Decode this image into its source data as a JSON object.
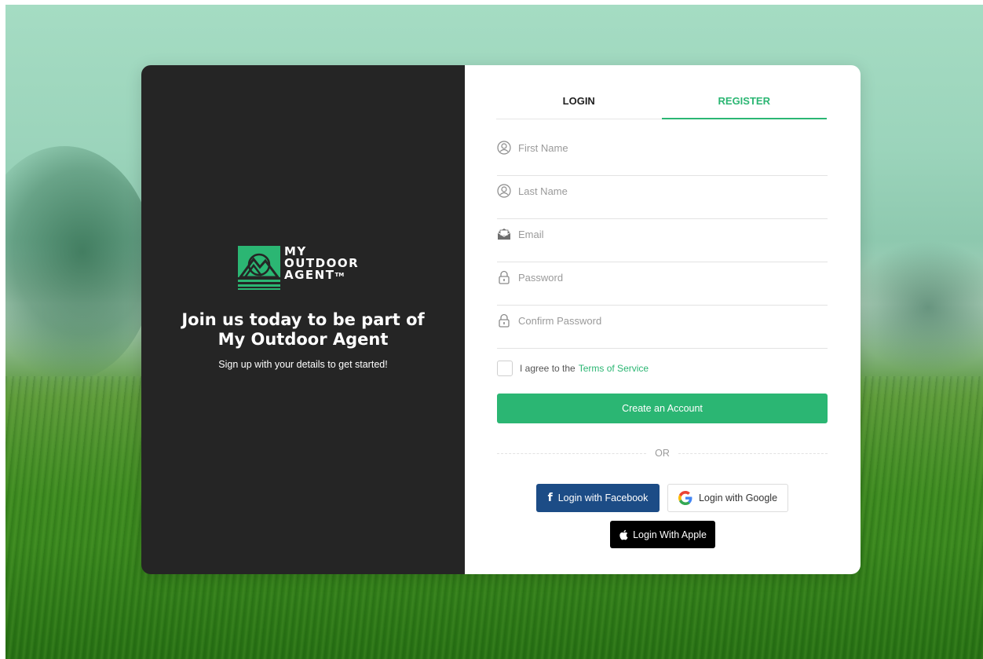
{
  "brand": {
    "logo_line1": "MY",
    "logo_line2": "OUTDOOR",
    "logo_line3": "AGENT",
    "trademark": "TM",
    "accent_color": "#2bb673",
    "dark_panel_color": "#252525"
  },
  "intro": {
    "headline_line1": "Join us today to be part of",
    "headline_line2": "My Outdoor Agent",
    "subline": "Sign up with your details to get started!"
  },
  "tabs": [
    {
      "label": "LOGIN",
      "active": false
    },
    {
      "label": "REGISTER",
      "active": true
    }
  ],
  "form": {
    "first_name": {
      "placeholder": "First Name",
      "value": "",
      "icon": "user-icon"
    },
    "last_name": {
      "placeholder": "Last Name",
      "value": "",
      "icon": "user-icon"
    },
    "email": {
      "placeholder": "Email",
      "value": "",
      "icon": "mail-icon"
    },
    "password": {
      "placeholder": "Password",
      "value": "",
      "icon": "lock-icon"
    },
    "confirm_password": {
      "placeholder": "Confirm Password",
      "value": "",
      "icon": "lock-icon"
    },
    "agree_prefix": "I agree to the",
    "agree_link": "Terms of Service",
    "agree_checked": false,
    "submit_label": "Create an Account"
  },
  "divider": {
    "label": "OR"
  },
  "social": {
    "facebook": {
      "label": "Login with Facebook",
      "color": "#1c4c86"
    },
    "google": {
      "label": "Login with Google"
    },
    "apple": {
      "label": "Login With Apple",
      "color": "#000000"
    }
  }
}
